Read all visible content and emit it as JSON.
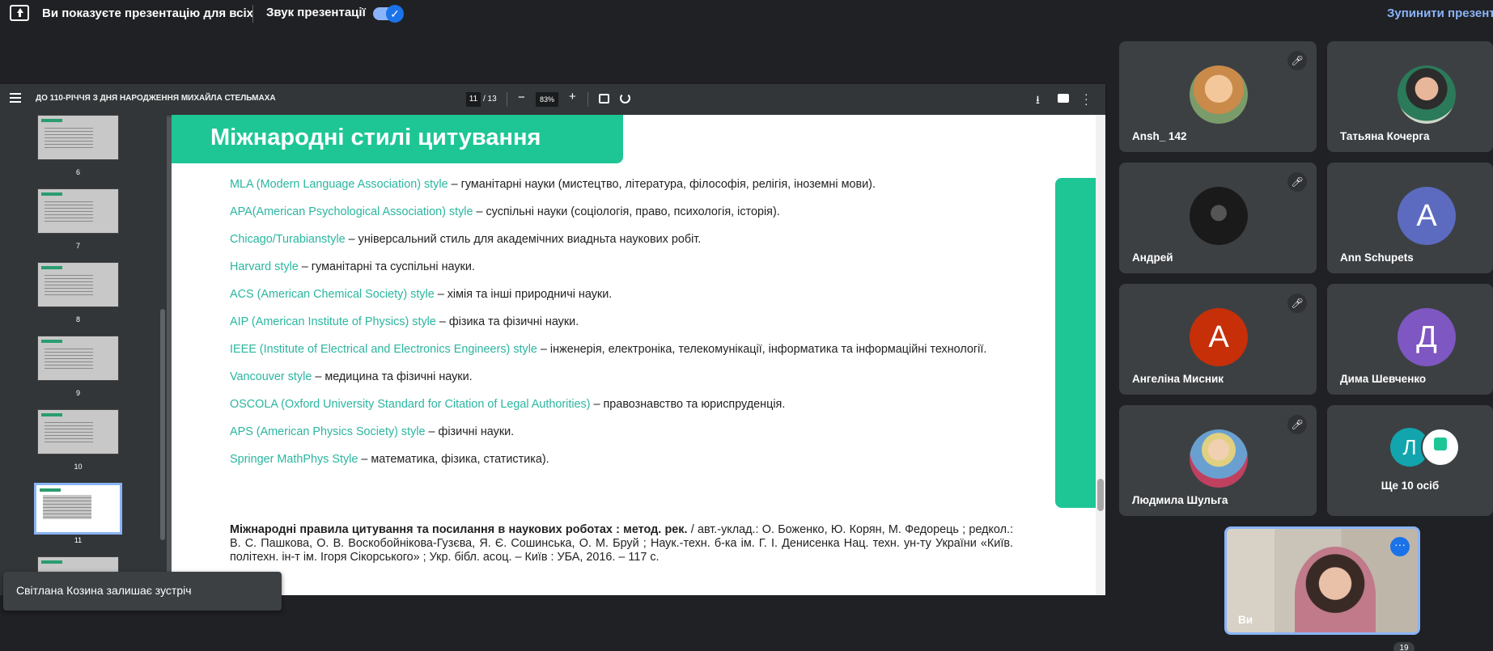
{
  "topbar": {
    "presenting_text": "Ви показуєте презентацію для всіх",
    "sound_label": "Звук презентації",
    "sound_enabled": true,
    "stop_label": "Зупинити презента",
    "accent": "#8ab4f8"
  },
  "viewer": {
    "doc_title": "ДО 110-РІЧЧЯ З ДНЯ НАРОДЖЕННЯ МИХАЙЛА СТЕЛЬМАХА",
    "page_current": "11",
    "page_total": "/ 13",
    "zoom": "83%",
    "zoom_out": "−",
    "zoom_in": "+",
    "thumbnails": [
      "6",
      "7",
      "8",
      "9",
      "10",
      "11"
    ],
    "selected_thumbnail": "11",
    "icons": [
      "menu-icon",
      "fit-page-icon",
      "rotate-icon",
      "download-icon",
      "print-icon",
      "more-vert-icon"
    ]
  },
  "slide": {
    "title": "Міжнародні стилі цитування",
    "accent": "#1ec696",
    "highlight_color": "#2bb6a0",
    "citations": [
      {
        "style": "MLA (Modern Language Association) style",
        "desc": " – гуманітарні науки (мистецтво, література, філософія, релігія, іноземні мови)."
      },
      {
        "style": "APA(American Psychological Association) style",
        "desc": " – суспільні науки (соціологія, право, психологія, історія)."
      },
      {
        "style": "Chicago/Turabianstyle",
        "desc": " – універсальний стиль для академічних виадньта наукових робіт."
      },
      {
        "style": "Harvard style",
        "desc": " – гуманітарні та суспільні науки."
      },
      {
        "style": "ACS (American Chemical Society) style",
        "desc": " – хімія та інші природничі науки."
      },
      {
        "style": "AIP (American Institute of Physics) style",
        "desc": " – фізика та фізичні науки."
      },
      {
        "style": "IEEE (Institute of Electrical and Electronics Engineers) style",
        "desc": " – інженерія, електроніка, телекомунікації, інформатика та інформаційні технології."
      },
      {
        "style": "Vancouver style",
        "desc": " – медицина та фізичні науки."
      },
      {
        "style": "OSCOLA (Oxford University Standard for Citation of Legal Authorities)",
        "desc": " – правознавство та юриспруденція."
      },
      {
        "style": "APS (American Physics Society) style",
        "desc": " – фізичні науки."
      },
      {
        "style": "Springer MathPhys Style",
        "desc": " – математика, фізика, статистика)."
      }
    ],
    "reference_bold": "Міжнародні правила цитування та посилання в наукових роботах : метод. рек.",
    "reference_rest": " / авт.-уклад.: О. Боженко, Ю. Корян, М. Федорець ; редкол.: В. С. Пашкова, О. В. Воскобойнікова-Гузєва, Я. Є. Сошинська, О. М. Бруй ; Наук.-техн. б-ка ім. Г. І. Денисенка Нац. техн. ун-ту України «Київ. політехн. ін-т ім. Ігоря Сікорського» ; Укр. бібл. асоц. – Київ : УБА, 2016. – 117 с."
  },
  "participants": [
    {
      "name": "Ansh_ 142",
      "avatar": "photo",
      "muted": true
    },
    {
      "name": "Татьяна Кочерга",
      "avatar": "photo",
      "muted": false
    },
    {
      "name": "Андрей",
      "avatar": "photo",
      "muted": true
    },
    {
      "name": "Ann Schupets",
      "initial": "A",
      "color": "#5c6bc0",
      "muted": false
    },
    {
      "name": "Ангеліна Мисник",
      "initial": "А",
      "color": "#c62f07",
      "muted": true
    },
    {
      "name": "Дима Шевченко",
      "initial": "Д",
      "color": "#7e57c2",
      "muted": false
    },
    {
      "name": "Людмила Шульга",
      "avatar": "photo",
      "muted": true
    }
  ],
  "more_tile": {
    "initial": "Л",
    "label": "Ще 10 осіб"
  },
  "self_view": {
    "name": "Ви",
    "count": "19"
  },
  "toast": {
    "text": "Світлана Козина залишає зустріч"
  }
}
